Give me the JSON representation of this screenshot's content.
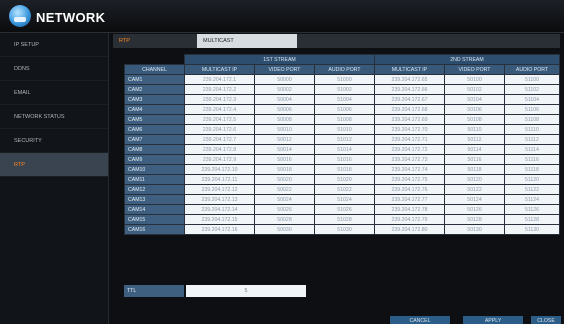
{
  "header": {
    "title": "NETWORK"
  },
  "sidebar": {
    "items": [
      {
        "label": "IP SETUP"
      },
      {
        "label": "DDNS"
      },
      {
        "label": "EMAIL"
      },
      {
        "label": "NETWORK STATUS"
      },
      {
        "label": "SECURITY"
      },
      {
        "label": "RTP"
      }
    ],
    "active_index": 5
  },
  "tabs": [
    {
      "label": "RTP"
    },
    {
      "label": "MULTICAST"
    }
  ],
  "table": {
    "group_headers": [
      "1ST STREAM",
      "2ND STREAM"
    ],
    "columns": [
      "CHANNEL",
      "MULTICAST IP",
      "VIDEO PORT",
      "AUDIO PORT",
      "MULTICAST IP",
      "VIDEO PORT",
      "AUDIO PORT"
    ],
    "rows": [
      [
        "CAM1",
        "239.204.172.1",
        "50000",
        "51000",
        "239.204.172.65",
        "50100",
        "51100"
      ],
      [
        "CAM2",
        "239.204.172.2",
        "50002",
        "51002",
        "239.204.172.66",
        "50102",
        "51102"
      ],
      [
        "CAM3",
        "239.204.172.3",
        "50004",
        "51004",
        "239.204.172.67",
        "50104",
        "51104"
      ],
      [
        "CAM4",
        "239.204.172.4",
        "50006",
        "51006",
        "239.204.172.68",
        "50106",
        "51106"
      ],
      [
        "CAM5",
        "239.204.172.5",
        "50008",
        "51008",
        "239.204.172.69",
        "50108",
        "51108"
      ],
      [
        "CAM6",
        "239.204.172.6",
        "50010",
        "51010",
        "239.204.172.70",
        "50110",
        "51110"
      ],
      [
        "CAM7",
        "239.204.172.7",
        "50012",
        "51012",
        "239.204.172.71",
        "50112",
        "51112"
      ],
      [
        "CAM8",
        "239.204.172.8",
        "50014",
        "51014",
        "239.204.172.72",
        "50114",
        "51114"
      ],
      [
        "CAM9",
        "239.204.172.9",
        "50016",
        "51016",
        "239.204.172.73",
        "50116",
        "51116"
      ],
      [
        "CAM10",
        "239.204.172.10",
        "50018",
        "51018",
        "239.204.172.74",
        "50118",
        "51118"
      ],
      [
        "CAM11",
        "239.204.172.11",
        "50020",
        "51020",
        "239.204.172.75",
        "50120",
        "51120"
      ],
      [
        "CAM12",
        "239.204.172.12",
        "50022",
        "51022",
        "239.204.172.76",
        "50122",
        "51122"
      ],
      [
        "CAM13",
        "239.204.172.13",
        "50024",
        "51024",
        "239.204.172.77",
        "50124",
        "51124"
      ],
      [
        "CAM14",
        "239.204.172.14",
        "50026",
        "51026",
        "239.204.172.78",
        "50126",
        "51126"
      ],
      [
        "CAM15",
        "239.204.172.15",
        "50028",
        "51028",
        "239.204.172.79",
        "50128",
        "51128"
      ],
      [
        "CAM16",
        "239.204.172.16",
        "50030",
        "51030",
        "239.204.172.80",
        "50130",
        "51130"
      ]
    ]
  },
  "ttl": {
    "label": "TTL",
    "value": "5"
  },
  "buttons": {
    "cancel": "CANCEL",
    "apply": "APPLY",
    "close": "CLOSE"
  }
}
